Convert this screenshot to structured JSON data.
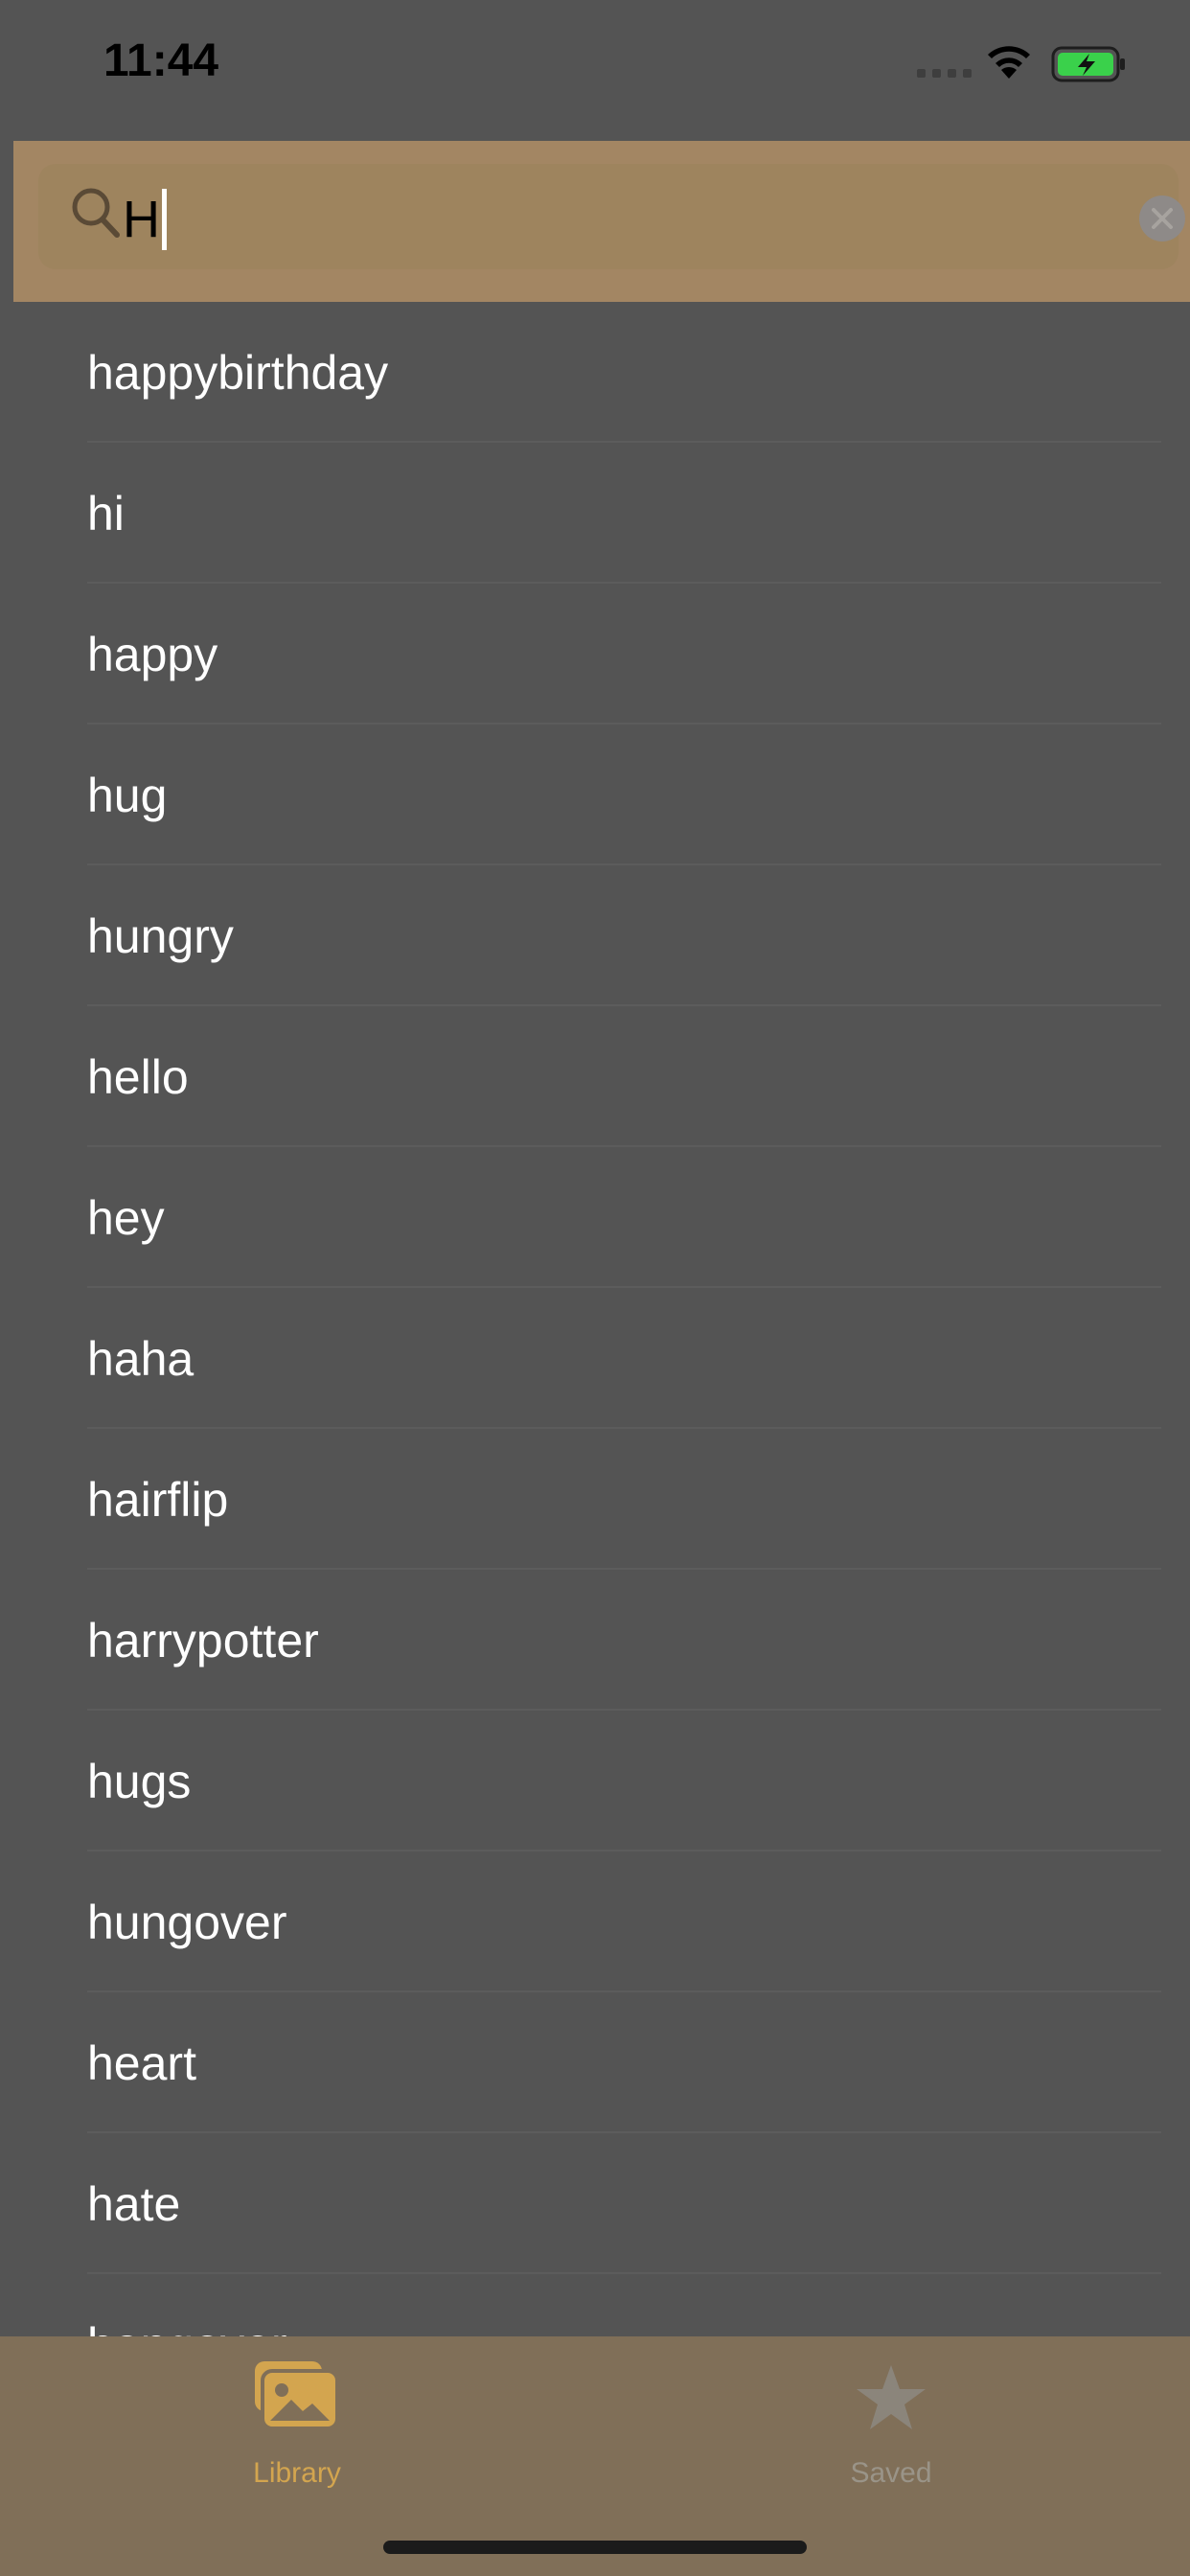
{
  "status_bar": {
    "time": "11:44",
    "icons": [
      "cellular-signal-icon",
      "wifi-icon",
      "battery-charging-icon"
    ]
  },
  "search": {
    "value": "H",
    "icons": [
      "search-icon",
      "clear-icon"
    ]
  },
  "results": [
    "happybirthday",
    "hi",
    "happy",
    "hug",
    "hungry",
    "hello",
    "hey",
    "haha",
    "hairflip",
    "harrypotter",
    "hugs",
    "hungover",
    "heart",
    "hate",
    "hangover"
  ],
  "tab_bar": {
    "library_label": "Library",
    "saved_label": "Saved",
    "selected": "Library"
  },
  "colors": {
    "background": "#545454",
    "search_bar": "#a38663",
    "tab_bar": "#806f58",
    "accent": "#d3a54f",
    "inactive_tab": "#9a9488",
    "battery_green": "#3ad14b"
  }
}
